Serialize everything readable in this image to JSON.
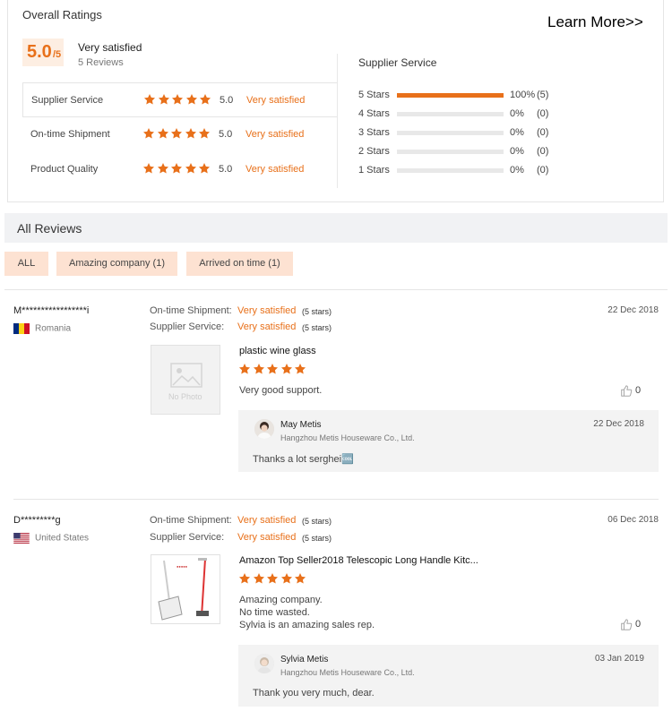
{
  "overall": {
    "title": "Overall Ratings",
    "learn_more": "Learn More>>",
    "score": "5.0",
    "score_max": "/5",
    "satisfaction": "Very satisfied",
    "review_count": "5 Reviews"
  },
  "categories": [
    {
      "label": "Supplier Service",
      "score": "5.0",
      "text": "Very satisfied",
      "rating": 5
    },
    {
      "label": "On-time Shipment",
      "score": "5.0",
      "text": "Very satisfied",
      "rating": 5
    },
    {
      "label": "Product Quality",
      "score": "5.0",
      "text": "Very satisfied",
      "rating": 5
    }
  ],
  "supplier_service": {
    "title": "Supplier Service",
    "bars": [
      {
        "label": "5 Stars",
        "percent": "100%",
        "count": "(5)",
        "fill": 1.0
      },
      {
        "label": "4 Stars",
        "percent": "0%",
        "count": "(0)",
        "fill": 0
      },
      {
        "label": "3 Stars",
        "percent": "0%",
        "count": "(0)",
        "fill": 0
      },
      {
        "label": "2 Stars",
        "percent": "0%",
        "count": "(0)",
        "fill": 0
      },
      {
        "label": "1 Stars",
        "percent": "0%",
        "count": "(0)",
        "fill": 0
      }
    ]
  },
  "all_reviews": {
    "title": "All Reviews",
    "filters": [
      "ALL",
      "Amazing company (1)",
      "Arrived on time (1)"
    ]
  },
  "reviews": [
    {
      "user": "M*****************i",
      "country": "Romania",
      "shipment_label": "On-time Shipment:",
      "shipment_value": "Very satisfied",
      "shipment_stars": "(5 stars)",
      "service_label": "Supplier Service:",
      "service_value": "Very satisfied",
      "service_stars": "(5 stars)",
      "date": "22 Dec 2018",
      "product": "plastic wine glass",
      "no_photo": "No Photo",
      "rating": 5,
      "text": [
        "Very good support."
      ],
      "likes": "0",
      "reply": {
        "name": "May Metis",
        "company": "Hangzhou Metis Houseware Co., Ltd.",
        "date": "22 Dec 2018",
        "text": "Thanks a lot serghei🆒"
      }
    },
    {
      "user": "D*********g",
      "country": "United States",
      "shipment_label": "On-time Shipment:",
      "shipment_value": "Very satisfied",
      "shipment_stars": "(5 stars)",
      "service_label": "Supplier Service:",
      "service_value": "Very satisfied",
      "service_stars": "(5 stars)",
      "date": "06 Dec 2018",
      "product": "Amazon Top Seller2018 Telescopic Long Handle Kitc...",
      "rating": 5,
      "text": [
        "Amazing company.",
        "No time wasted.",
        "Sylvia is an amazing sales rep."
      ],
      "likes": "0",
      "reply": {
        "name": "Sylvia Metis",
        "company": "Hangzhou Metis Houseware Co., Ltd.",
        "date": "03 Jan 2019",
        "text": "Thank you very much, dear."
      }
    }
  ],
  "colors": {
    "accent": "#e8701a",
    "badge_bg": "#fdeee2",
    "filter_bg": "#fde2d2",
    "bar_track": "#e8e8e8"
  },
  "icons": {
    "star": "star-icon",
    "like": "thumbs-up-icon",
    "flag_ro": "romania-flag-icon",
    "flag_us": "us-flag-icon"
  }
}
